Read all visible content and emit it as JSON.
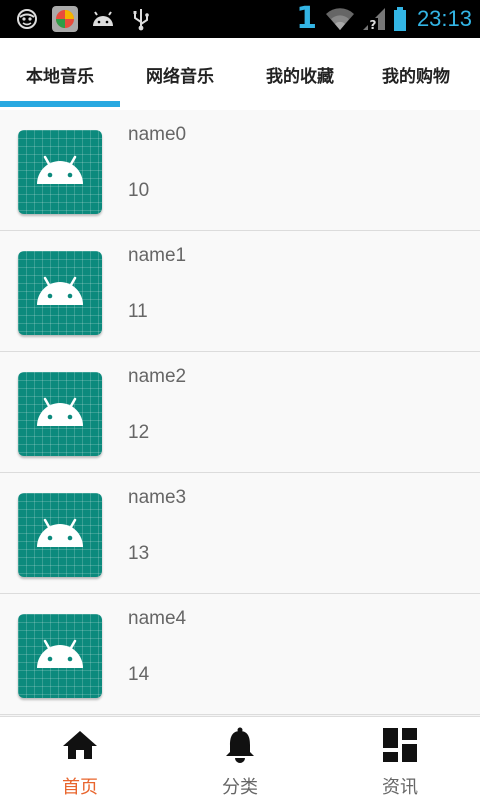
{
  "statusbar": {
    "signal_digit": "1",
    "time": "23:13",
    "icons": [
      "smiley-face-icon",
      "app-ball-icon",
      "android-head-icon",
      "usb-icon",
      "wifi-icon",
      "no-signal-icon",
      "battery-icon"
    ]
  },
  "tabs": [
    {
      "label": "本地音乐",
      "active": true
    },
    {
      "label": "网络音乐",
      "active": false
    },
    {
      "label": "我的收藏",
      "active": false
    },
    {
      "label": "我的购物",
      "active": false
    }
  ],
  "list": [
    {
      "name": "name0",
      "number": "10"
    },
    {
      "name": "name1",
      "number": "11"
    },
    {
      "name": "name2",
      "number": "12"
    },
    {
      "name": "name3",
      "number": "13"
    },
    {
      "name": "name4",
      "number": "14"
    }
  ],
  "bottom_nav": [
    {
      "label": "首页",
      "icon": "home-icon",
      "active": true
    },
    {
      "label": "分类",
      "icon": "bell-icon",
      "active": false
    },
    {
      "label": "资讯",
      "icon": "dashboard-icon",
      "active": false
    }
  ],
  "colors": {
    "accent": "#29a9e1",
    "active_nav": "#e8652d",
    "thumb": "#0c8a7d",
    "statusbar_text": "#33b5e5"
  }
}
